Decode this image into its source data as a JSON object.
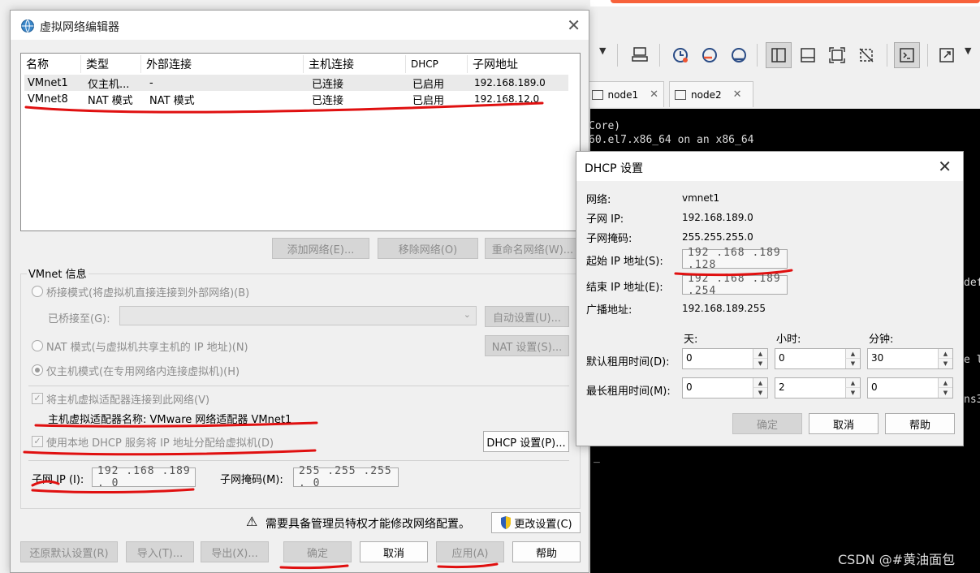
{
  "main": {
    "title": "虚拟网络编辑器",
    "columns": [
      "名称",
      "类型",
      "外部连接",
      "主机连接",
      "DHCP",
      "子网地址"
    ],
    "rows": [
      [
        "VMnet1",
        "仅主机...",
        "-",
        "已连接",
        "已启用",
        "192.168.189.0"
      ],
      [
        "VMnet8",
        "NAT 模式",
        "NAT 模式",
        "已连接",
        "已启用",
        "192.168.12.0"
      ]
    ],
    "buttons": {
      "add_network": "添加网络(E)...",
      "remove_network": "移除网络(O)",
      "rename_network": "重命名网络(W)...",
      "auto_settings": "自动设置(U)...",
      "nat_settings": "NAT 设置(S)...",
      "dhcp_settings": "DHCP 设置(P)...",
      "change_settings": "更改设置(C)",
      "restore_defaults": "还原默认设置(R)",
      "import": "导入(T)...",
      "export": "导出(X)...",
      "ok": "确定",
      "cancel": "取消",
      "apply": "应用(A)",
      "help": "帮助"
    },
    "vmnet_info": {
      "group_title": "VMnet 信息",
      "bridge_mode": "桥接模式(将虚拟机直接连接到外部网络)(B)",
      "bridged_to": "已桥接至(G):",
      "nat_mode": "NAT 模式(与虚拟机共享主机的 IP 地址)(N)",
      "host_only_mode": "仅主机模式(在专用网络内连接虚拟机)(H)",
      "connect_adapter": "将主机虚拟适配器连接到此网络(V)",
      "adapter_name": "主机虚拟适配器名称: VMware 网络适配器 VMnet1",
      "use_dhcp": "使用本地 DHCP 服务将 IP 地址分配给虚拟机(D)",
      "subnet_ip_label": "子网 IP (I):",
      "subnet_ip_value": "192 .168 .189 . 0",
      "subnet_mask_label": "子网掩码(M):",
      "subnet_mask_value": "255 .255 .255 . 0"
    },
    "admin_warning": "需要具备管理员特权才能修改网络配置。"
  },
  "background": {
    "tabs": [
      "node1",
      "node2"
    ],
    "terminal_lines": [
      "Core)",
      "60.el7.x86_64 on an x86_64",
      "def",
      "e l",
      "ns3",
      "_"
    ],
    "watermark": "CSDN @#黄油面包"
  },
  "dhcp": {
    "title": "DHCP 设置",
    "network_label": "网络:",
    "network_value": "vmnet1",
    "subnet_ip_label": "子网 IP:",
    "subnet_ip_value": "192.168.189.0",
    "subnet_mask_label": "子网掩码:",
    "subnet_mask_value": "255.255.255.0",
    "start_ip_label": "起始 IP 地址(S):",
    "start_ip_value": "192 .168 .189 .128",
    "end_ip_label": "结束 IP 地址(E):",
    "end_ip_value": "192 .168 .189 .254",
    "broadcast_label": "广播地址:",
    "broadcast_value": "192.168.189.255",
    "col_days": "天:",
    "col_hours": "小时:",
    "col_minutes": "分钟:",
    "default_lease_label": "默认租用时间(D):",
    "default_lease": [
      "0",
      "0",
      "30"
    ],
    "max_lease_label": "最长租用时间(M):",
    "max_lease": [
      "0",
      "2",
      "0"
    ],
    "ok": "确定",
    "cancel": "取消",
    "help": "帮助"
  },
  "colors": {
    "annotation_red": "#e01010",
    "terminal_bg": "#000000",
    "dialog_bg": "#f0f0f0"
  }
}
